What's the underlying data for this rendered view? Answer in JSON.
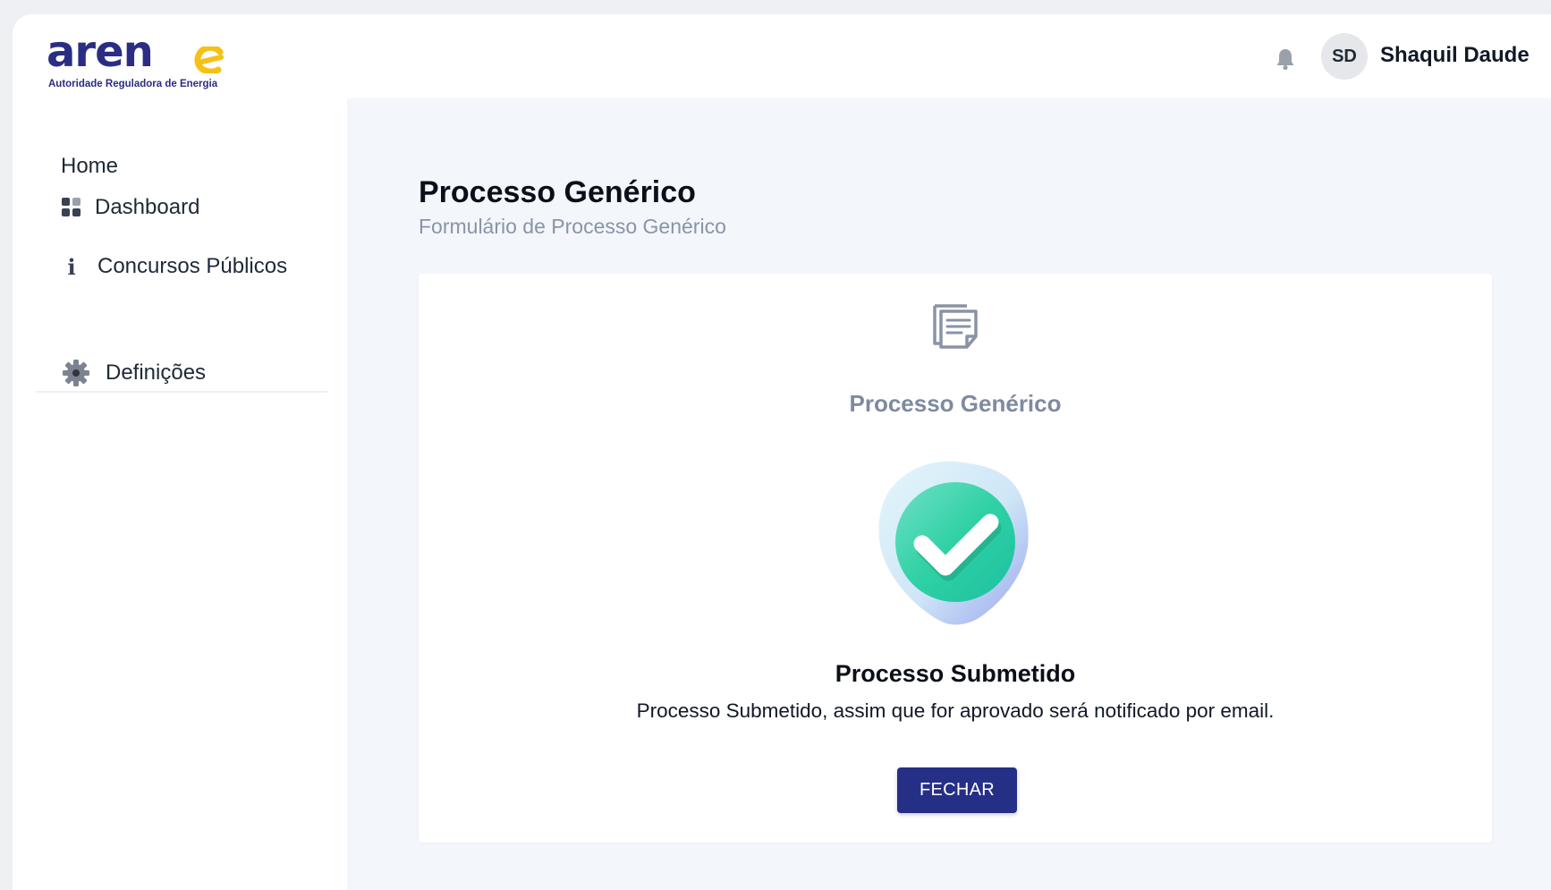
{
  "header": {
    "logo_text": "aren",
    "logo_tagline": "Autoridade Reguladora de Energia",
    "avatar_initials": "SD",
    "user_name": "Shaquil Daude"
  },
  "sidebar": {
    "heading": "Home",
    "items": [
      {
        "label": "Dashboard",
        "icon": "dashboard-grid-icon"
      },
      {
        "label": "Concursos Públicos",
        "icon": "info-icon"
      }
    ],
    "settings": {
      "label": "Definições",
      "icon": "gear-icon"
    }
  },
  "main": {
    "title": "Processo Genérico",
    "subtitle": "Formulário de Processo Genérico",
    "card": {
      "title": "Processo Genérico",
      "success_title": "Processo Submetido",
      "success_message": "Processo Submetido, assim que for aprovado será notificado por email.",
      "close_label": "FECHAR"
    }
  },
  "colors": {
    "brand_navy": "#2a2d83",
    "brand_yellow": "#f5c118",
    "button": "#252f86",
    "success_green": "#2fd6a3",
    "muted_text": "#8a94a6"
  }
}
